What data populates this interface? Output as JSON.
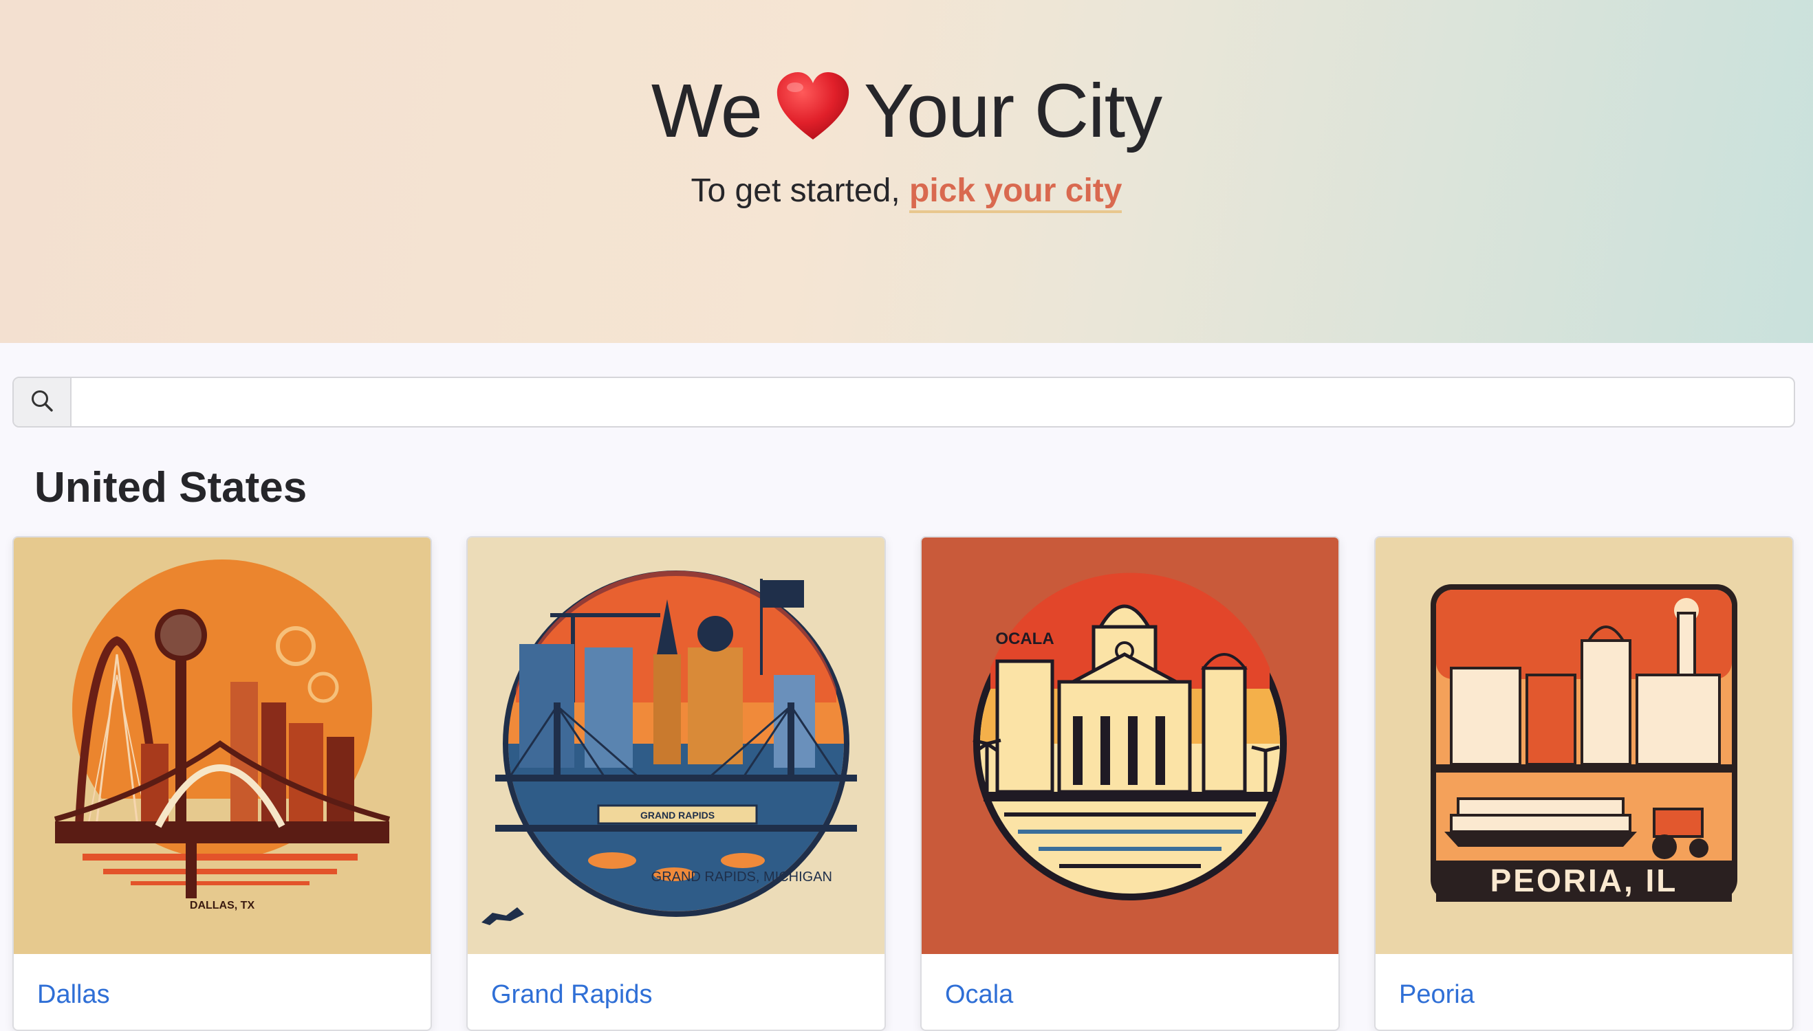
{
  "hero": {
    "title_before": "We",
    "title_after": "Your City",
    "subtitle_prefix": "To get started,",
    "subtitle_link": "pick your city",
    "heart_icon": "heart-icon",
    "link_color": "#d9694f"
  },
  "search": {
    "icon": "search-icon",
    "value": "",
    "placeholder": ""
  },
  "section": {
    "title": "United States"
  },
  "cities": [
    {
      "name": "Dallas",
      "badge_text": "DALLAS, TX"
    },
    {
      "name": "Grand Rapids",
      "badge_text": "GRAND RAPIDS",
      "badge_text_2": "GRAND RAPIDS, MICHIGAN"
    },
    {
      "name": "Ocala",
      "badge_text": "OCALA"
    },
    {
      "name": "Peoria",
      "badge_text": "PEORIA, IL"
    }
  ],
  "colors": {
    "accent_link": "#2f6fd6",
    "hero_link": "#d9694f"
  }
}
